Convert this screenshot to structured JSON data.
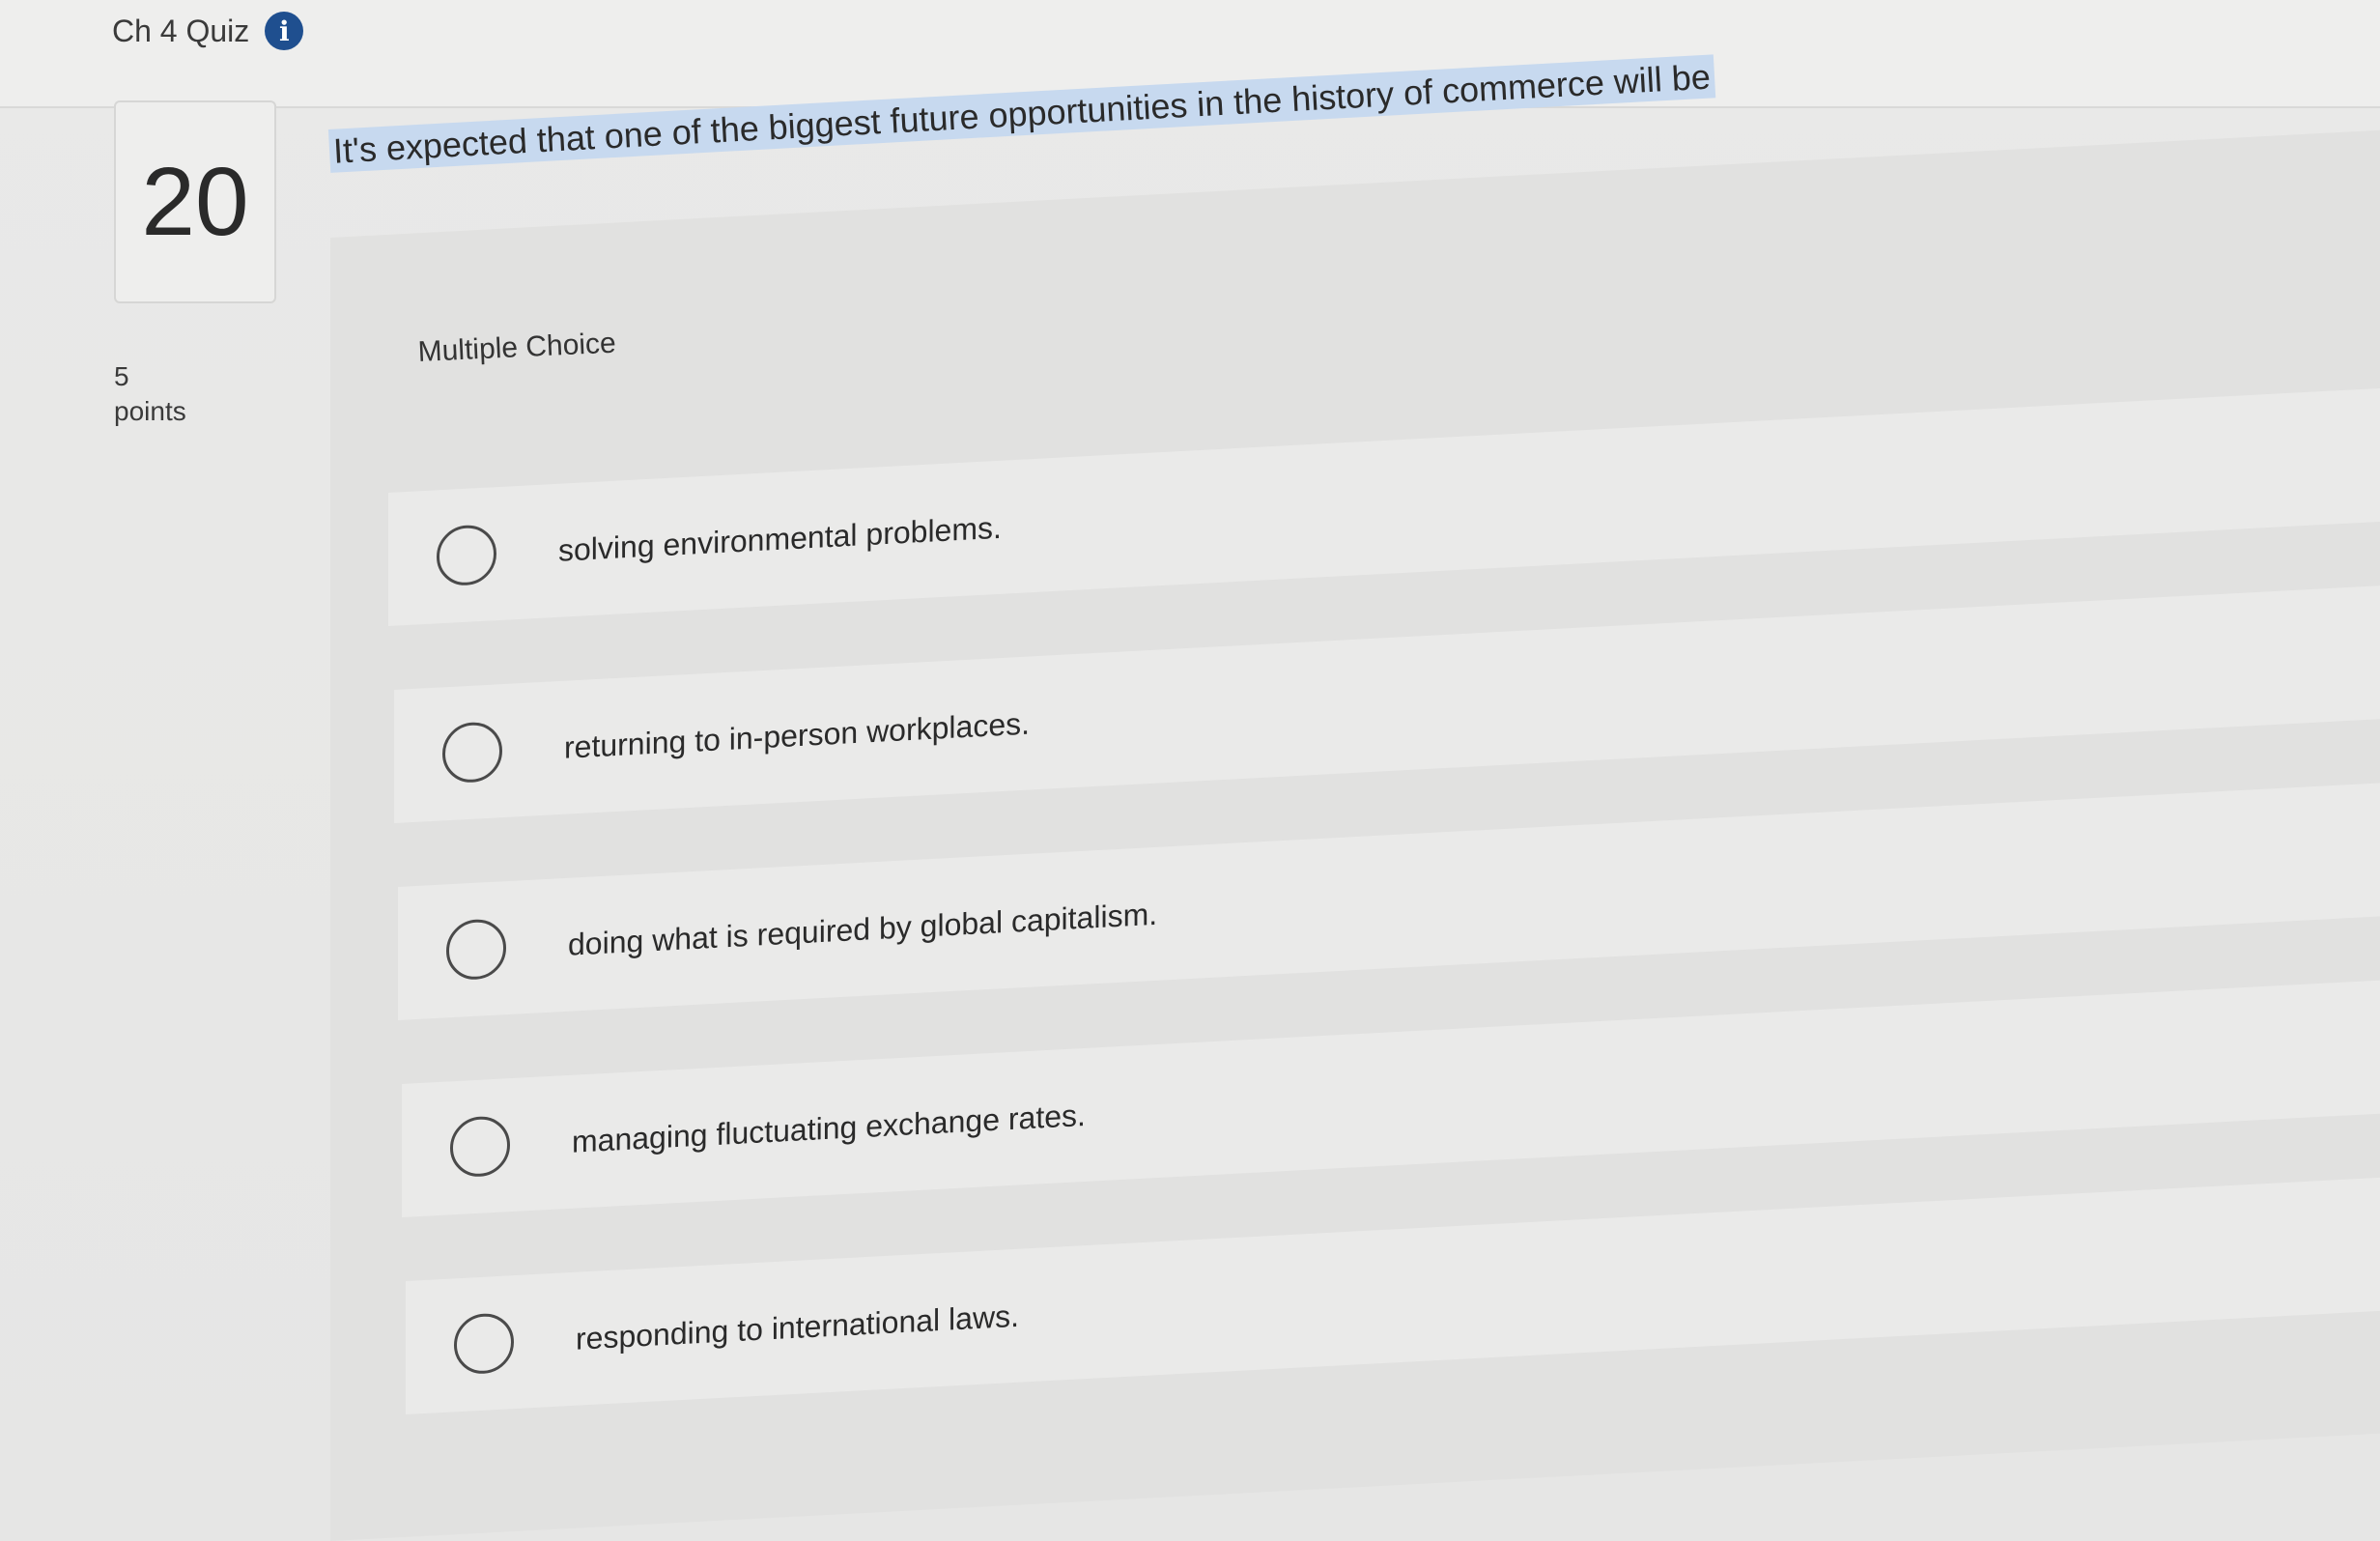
{
  "header": {
    "quiz_title": "Ch 4 Quiz",
    "info_icon": "info-icon"
  },
  "question": {
    "number": "20",
    "points_value": "5",
    "points_label": "points",
    "text": "It's expected that one of the biggest future opportunities in the history of commerce will be",
    "type_label": "Multiple Choice",
    "highlight_color": "#c7d9ef"
  },
  "choices": [
    {
      "label": "solving environmental problems."
    },
    {
      "label": "returning to in-person workplaces."
    },
    {
      "label": "doing what is required by global capitalism."
    },
    {
      "label": "managing fluctuating exchange rates."
    },
    {
      "label": "responding to international laws."
    }
  ]
}
